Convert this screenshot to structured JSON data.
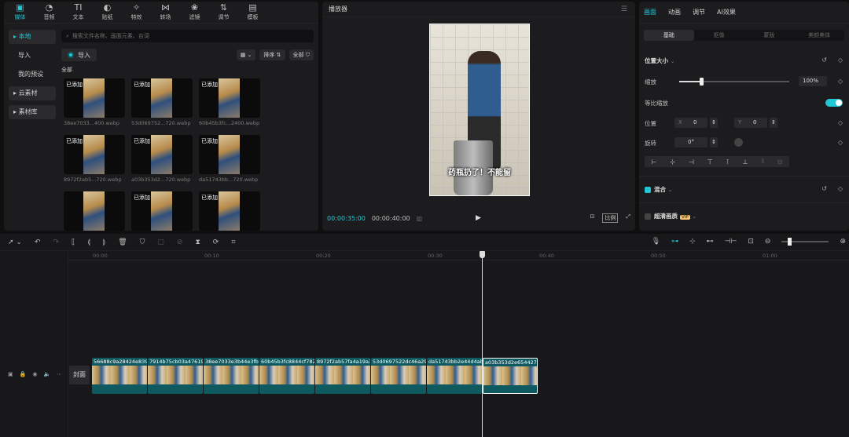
{
  "media": {
    "tools": [
      {
        "label": "媒体",
        "icon": "media-icon",
        "glyph": "▣"
      },
      {
        "label": "音频",
        "icon": "audio-icon",
        "glyph": "◔"
      },
      {
        "label": "文本",
        "icon": "text-icon",
        "glyph": "TI"
      },
      {
        "label": "贴纸",
        "icon": "sticker-icon",
        "glyph": "◐"
      },
      {
        "label": "特效",
        "icon": "effects-icon",
        "glyph": "✧"
      },
      {
        "label": "转场",
        "icon": "transition-icon",
        "glyph": "⋈"
      },
      {
        "label": "滤镜",
        "icon": "filter-icon",
        "glyph": "❀"
      },
      {
        "label": "调节",
        "icon": "adjust-icon",
        "glyph": "⇅"
      },
      {
        "label": "模板",
        "icon": "template-icon",
        "glyph": "▤"
      }
    ],
    "sidebar": [
      {
        "label": "本地",
        "style": "sel"
      },
      {
        "label": "导入",
        "style": "plain"
      },
      {
        "label": "我的预设",
        "style": "plain"
      },
      {
        "label": "云素材",
        "style": "box"
      },
      {
        "label": "素材库",
        "style": "box"
      }
    ],
    "search_placeholder": "搜索文件名称、画面元素、台词",
    "import_label": "导入",
    "sort_label": "排序",
    "filter_label": "全部",
    "section_label": "全部",
    "items": [
      {
        "tag": "已添加",
        "name": "38ee7033...400.webp"
      },
      {
        "tag": "已添加",
        "name": "53d069752...720.webp"
      },
      {
        "tag": "已添加",
        "name": "60b45b3fc...2400.webp"
      },
      {
        "tag": "已添加",
        "name": "8972f2ab5...720.webp"
      },
      {
        "tag": "已添加",
        "name": "a03b353d2...720.webp"
      },
      {
        "tag": "已添加",
        "name": "da51743bb...720.webp"
      },
      {
        "tag": "",
        "name": ""
      },
      {
        "tag": "已添加",
        "name": ""
      },
      {
        "tag": "已添加",
        "name": ""
      }
    ]
  },
  "player": {
    "title": "播放器",
    "subtitle": "药瓶扔了！不能留",
    "time_current": "00:00:35:00",
    "time_total": "00:00:40:00",
    "ratio_label": "比例"
  },
  "props": {
    "tabs": [
      {
        "label": "画面",
        "active": true
      },
      {
        "label": "动画",
        "active": false
      },
      {
        "label": "调节",
        "active": false
      },
      {
        "label": "AI效果",
        "active": false
      }
    ],
    "subtabs": [
      {
        "label": "基础",
        "active": true
      },
      {
        "label": "抠像",
        "active": false
      },
      {
        "label": "蒙版",
        "active": false
      },
      {
        "label": "美颜美体",
        "active": false
      }
    ],
    "position_size_label": "位置大小",
    "scale_label": "缩放",
    "scale_value": "100%",
    "scale_fraction": 0.21,
    "uniform_scale_label": "等比缩放",
    "position_label": "位置",
    "x_label": "X",
    "x_value": "0",
    "y_label": "Y",
    "y_value": "0",
    "rotate_label": "旋转",
    "rotate_value": "0°",
    "blend_label": "混合",
    "hd_label": "超清画质",
    "vip_label": "VIP"
  },
  "timeline": {
    "ruler": [
      "00:00",
      "00:10",
      "00:20",
      "00:30",
      "00:40",
      "00:50",
      "01:00"
    ],
    "cover_label": "封面",
    "clips": [
      {
        "name": "56688c9a28424e8398"
      },
      {
        "name": "7914b75cb03a47619("
      },
      {
        "name": "38ee7033e3b44e3fb1"
      },
      {
        "name": "60b45b3fc8844cf782"
      },
      {
        "name": "8972f2ab57fa4a19a3"
      },
      {
        "name": "53d0697522dc46a29"
      },
      {
        "name": "da51743bb2e44d4ab"
      },
      {
        "name": "a03b353d2e654427b"
      }
    ]
  }
}
